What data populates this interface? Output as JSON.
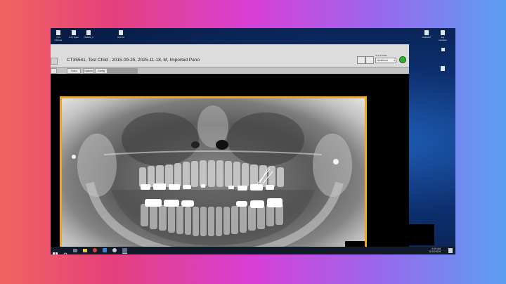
{
  "desktop": {
    "top_icons": [
      {
        "label": "CT3 Chrome"
      },
      {
        "label": "CT3 Team"
      },
      {
        "label": "TMAPE_2"
      },
      {
        "label": "DCF M"
      }
    ],
    "right_icons": [
      {
        "label": "GADGET"
      },
      {
        "label": "log numbers"
      }
    ]
  },
  "app": {
    "title": "CT35541, Test Child , 2015-09-25, 2025-11-18, M, Imported Pano",
    "toolbar": {
      "buttons": [
        "Tools",
        "Options",
        "Config"
      ]
    },
    "status_label": "STL STORE",
    "status_value": "Undefined"
  },
  "taskbar": {
    "time": "9:05 AM",
    "date": "11/18/2025"
  },
  "colors": {
    "frame_border": "#f2a81c",
    "status_dot": "#2fb12f"
  }
}
